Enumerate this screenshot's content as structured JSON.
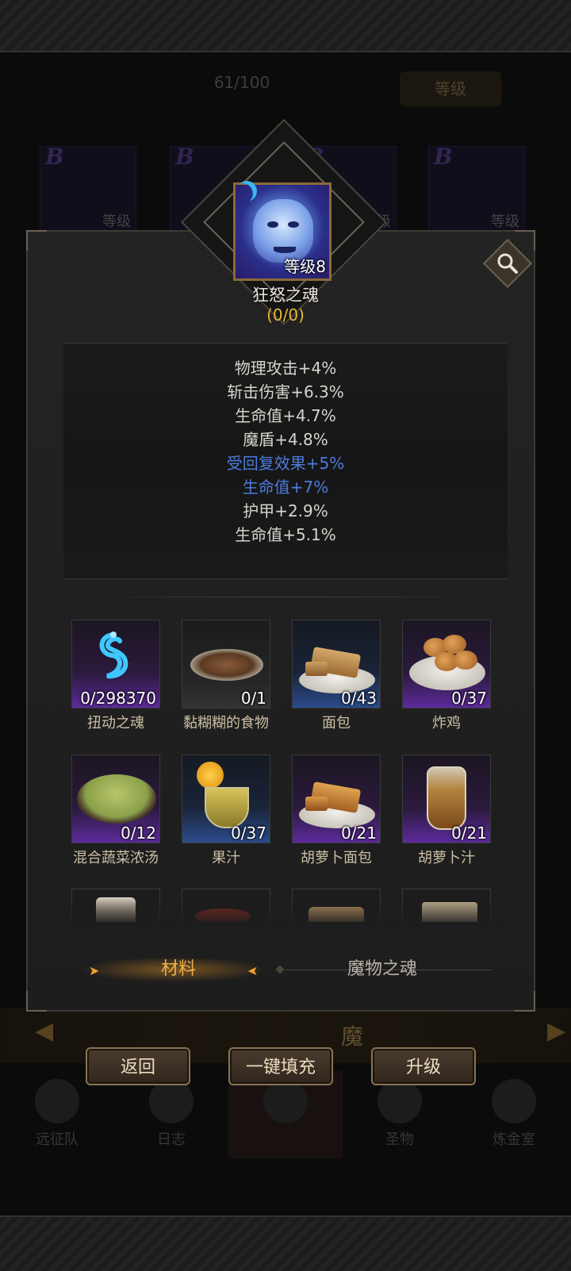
{
  "background": {
    "progress": "61/100",
    "level_button": "等级",
    "card_level": "等级",
    "banner_text": "魔",
    "nav": [
      "远征队",
      "日志",
      "",
      "圣物",
      "炼金室"
    ]
  },
  "soul": {
    "level_badge": "等级8",
    "name": "狂怒之魂",
    "count": "(0/0)"
  },
  "stats": [
    {
      "text": "物理攻击+4%",
      "color": "white"
    },
    {
      "text": "斩击伤害+6.3%",
      "color": "white"
    },
    {
      "text": "生命值+4.7%",
      "color": "white"
    },
    {
      "text": "魔盾+4.8%",
      "color": "white"
    },
    {
      "text": "受回复效果+5%",
      "color": "blue"
    },
    {
      "text": "生命值+7%",
      "color": "blue"
    },
    {
      "text": "护甲+2.9%",
      "color": "white"
    },
    {
      "text": "生命值+5.1%",
      "color": "white"
    }
  ],
  "items": [
    {
      "name": "扭动之魂",
      "count": "0/298370",
      "rarity": "purple",
      "icon": "soul-wisp-icon"
    },
    {
      "name": "黏糊糊的食物",
      "count": "0/1",
      "rarity": "dark",
      "icon": "sticky-food-icon"
    },
    {
      "name": "面包",
      "count": "0/43",
      "rarity": "blue",
      "icon": "bread-icon"
    },
    {
      "name": "炸鸡",
      "count": "0/37",
      "rarity": "purple",
      "icon": "fried-chicken-icon"
    },
    {
      "name": "混合蔬菜浓汤",
      "count": "0/12",
      "rarity": "purple",
      "icon": "vegetable-soup-icon"
    },
    {
      "name": "果汁",
      "count": "0/37",
      "rarity": "blue",
      "icon": "juice-icon"
    },
    {
      "name": "胡萝卜面包",
      "count": "0/21",
      "rarity": "purple",
      "icon": "carrot-bread-icon"
    },
    {
      "name": "胡萝卜汁",
      "count": "0/21",
      "rarity": "purple",
      "icon": "carrot-juice-icon"
    }
  ],
  "tabs": {
    "materials": "材料",
    "monster_souls": "魔物之魂"
  },
  "buttons": {
    "back": "返回",
    "auto_fill": "一键填充",
    "upgrade": "升级"
  },
  "colors": {
    "gold": "#e6b833",
    "blue_stat": "#4d7bdc",
    "active_tab": "#f0b04a"
  }
}
